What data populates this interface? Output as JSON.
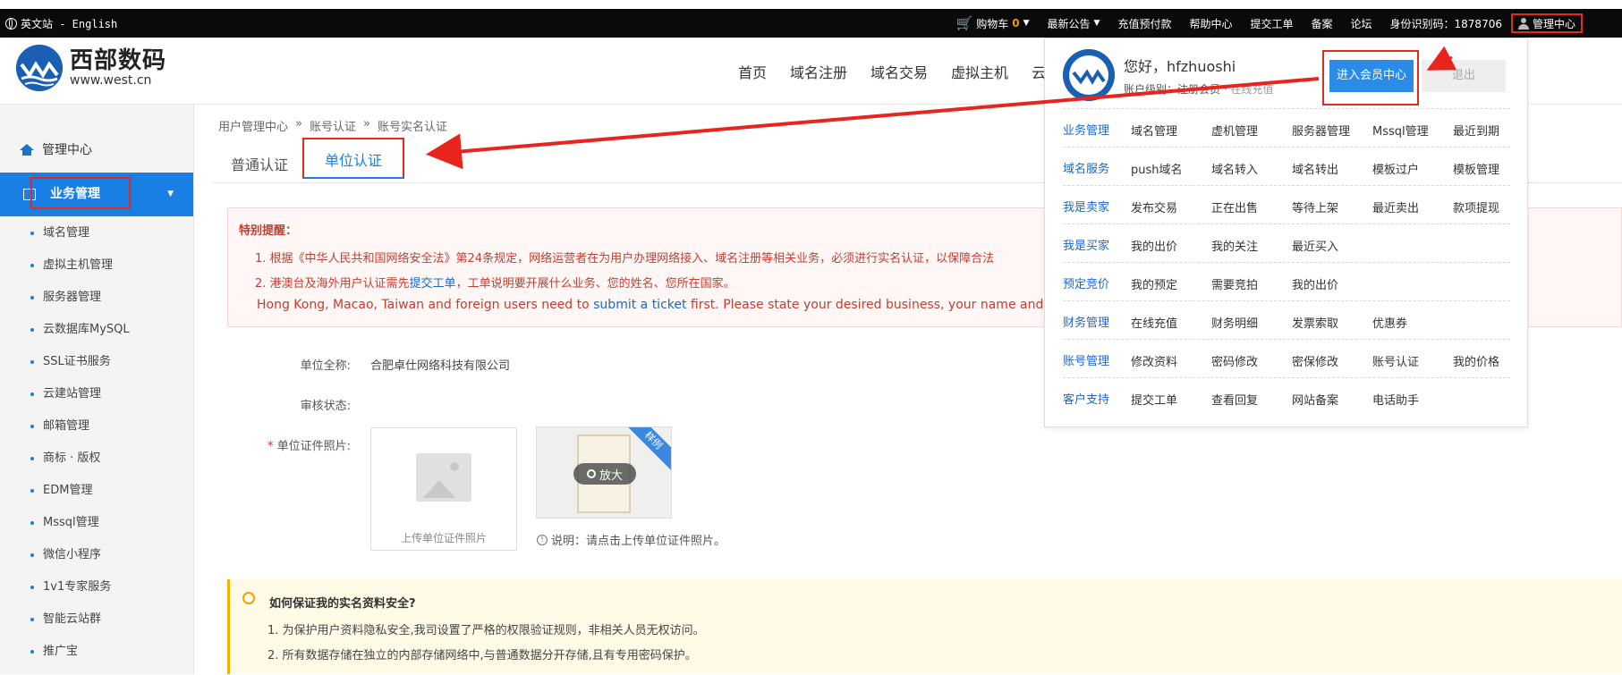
{
  "topbar": {
    "lang": "英文站 - English",
    "items": [
      {
        "label": "购物车",
        "count": "0"
      },
      {
        "label": "最新公告"
      },
      {
        "label": "充值预付款"
      },
      {
        "label": "帮助中心"
      },
      {
        "label": "提交工单"
      },
      {
        "label": "备案"
      },
      {
        "label": "论坛"
      },
      {
        "label": "身份识别码：1878706"
      }
    ],
    "admin": "管理中心"
  },
  "logo": {
    "name": "西部数码",
    "url": "www.west.cn"
  },
  "mainnav": [
    "首页",
    "域名注册",
    "域名交易",
    "虚拟主机",
    "云"
  ],
  "sidebar": {
    "home": "管理中心",
    "active": "业务管理",
    "items": [
      "域名管理",
      "虚拟主机管理",
      "服务器管理",
      "云数据库MySQL",
      "SSL证书服务",
      "云建站管理",
      "邮箱管理",
      "商标 · 版权",
      "EDM管理",
      "Mssql管理",
      "微信小程序",
      "1v1专家服务",
      "智能云站群",
      "推广宝"
    ]
  },
  "breadcrumb": [
    "用户管理中心",
    "账号认证",
    "账号实名认证"
  ],
  "tabs": {
    "normal": "普通认证",
    "unit": "单位认证"
  },
  "notice": {
    "title": "特别提醒：",
    "line1": "1. 根据《中华人民共和国网络安全法》第24条规定，网络运营者在为用户办理网络接入、域名注册等相关业务，必须进行实名认证，以保障合法",
    "line2_a": "2. 港澳台及海外用户认证需先",
    "line2_link": "提交工单",
    "line2_b": "，工单说明要开展什么业务、您的姓名、您所在国家。",
    "en_a": "Hong Kong, Macao, Taiwan and foreign users need to ",
    "en_link": "submit a ticket",
    "en_b": " first. Please state your desired business, your name and countr"
  },
  "form": {
    "name_label": "单位全称:",
    "name_value": "合肥卓仕网络科技有限公司",
    "status_label": "审核状态:",
    "photo_label": "单位证件照片:",
    "upload_label": "上传单位证件照片",
    "sample_badge": "样例",
    "zoom": "放大",
    "note": "说明：请点击上传单位证件照片。"
  },
  "tip": {
    "title": "如何保证我的实名资料安全?",
    "line1": "1. 为保护用户资料隐私安全,我司设置了严格的权限验证规则，非相关人员无权访问。",
    "line2": "2. 所有数据存储在独立的内部存储网络中,与普通数据分开存储,且有专用密码保护。"
  },
  "dropdown": {
    "hello": "您好，hfzhuoshi",
    "level_a": "账户级别：注册会员",
    "level_b": "· 在线充值",
    "enter": "进入会员中心",
    "logout": "退出",
    "rows": [
      {
        "cat": "业务管理",
        "links": [
          "域名管理",
          "虚机管理",
          "服务器管理",
          "Mssql管理",
          "最近到期"
        ]
      },
      {
        "cat": "域名服务",
        "links": [
          "push域名",
          "域名转入",
          "域名转出",
          "模板过户",
          "模板管理"
        ]
      },
      {
        "cat": "我是卖家",
        "links": [
          "发布交易",
          "正在出售",
          "等待上架",
          "最近卖出",
          "款项提现"
        ]
      },
      {
        "cat": "我是买家",
        "links": [
          "我的出价",
          "我的关注",
          "最近买入"
        ]
      },
      {
        "cat": "预定竞价",
        "links": [
          "我的预定",
          "需要竞拍",
          "我的出价"
        ]
      },
      {
        "cat": "财务管理",
        "links": [
          "在线充值",
          "财务明细",
          "发票索取",
          "优惠券"
        ]
      },
      {
        "cat": "账号管理",
        "links": [
          "修改资料",
          "密码修改",
          "密保修改",
          "账号认证",
          "我的价格"
        ]
      },
      {
        "cat": "客户支持",
        "links": [
          "提交工单",
          "查看回复",
          "网站备案",
          "电话助手"
        ]
      }
    ]
  },
  "colors": {
    "accent": "#1a7fe3",
    "highlight": "#e32a1f",
    "notice_text": "#c43d2e"
  }
}
